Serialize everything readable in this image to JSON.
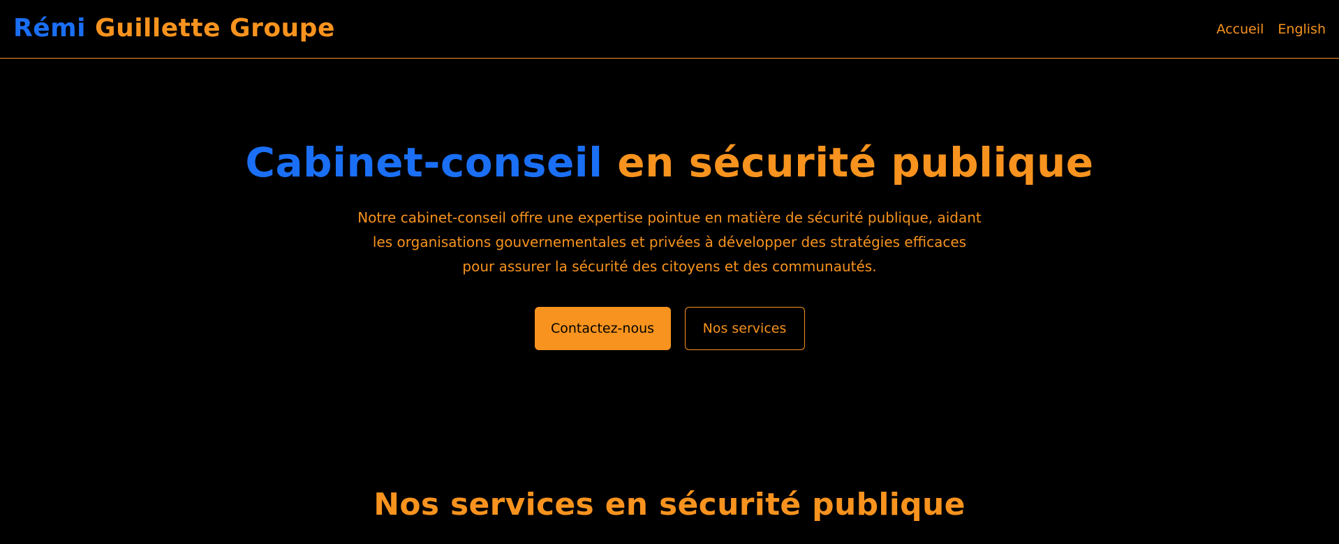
{
  "header": {
    "logo_first": "Rémi",
    "logo_rest": " Guillette Groupe",
    "nav": [
      {
        "label": "Accueil"
      },
      {
        "label": "English"
      }
    ]
  },
  "hero": {
    "title_blue": "Cabinet-conseil",
    "title_orange": " en sécurité publique",
    "description": "Notre cabinet-conseil offre une expertise pointue en matière de sécurité publique, aidant les organisations gouvernementales et privées à développer des stratégies efficaces pour assurer la sécurité des citoyens et des communautés.",
    "primary_button": "Contactez-nous",
    "secondary_button": "Nos services"
  },
  "services": {
    "title": "Nos services en sécurité publique"
  },
  "colors": {
    "background": "#000000",
    "accent_orange": "#f7931e",
    "accent_blue": "#1a6ff5"
  }
}
